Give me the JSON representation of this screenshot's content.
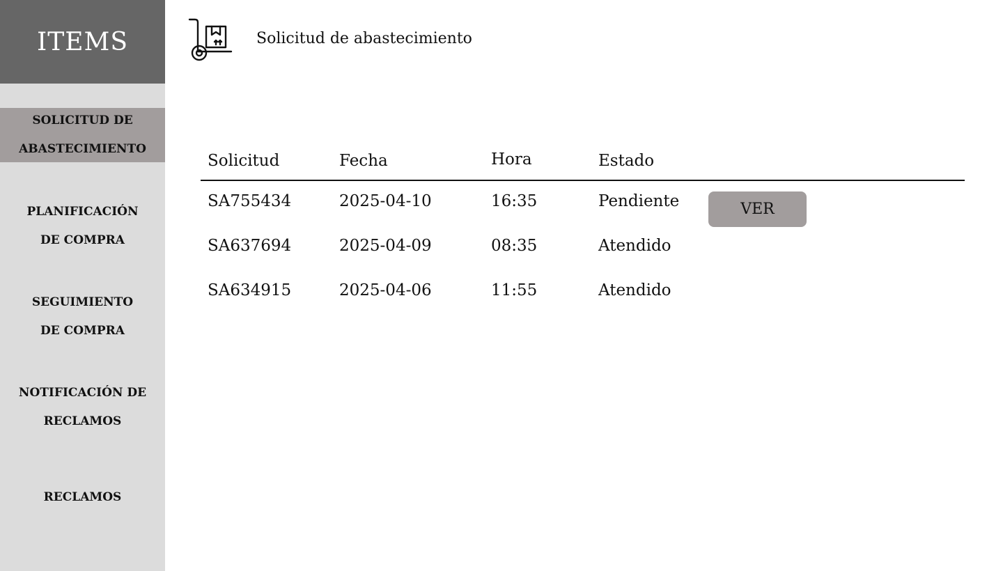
{
  "sidebar": {
    "title": "ITEMS",
    "items": [
      {
        "label": "SOLICITUD DE\nABASTECIMIENTO",
        "active": true
      },
      {
        "label": "PLANIFICACIÓN\nDE COMPRA",
        "active": false
      },
      {
        "label": "SEGUIMIENTO\nDE COMPRA",
        "active": false
      },
      {
        "label": "NOTIFICACIÓN DE\nRECLAMOS",
        "active": false
      },
      {
        "label": "RECLAMOS",
        "active": false
      }
    ]
  },
  "header": {
    "icon": "hand-truck-box-icon",
    "title": "Solicitud de abastecimiento"
  },
  "table": {
    "columns": [
      "Solicitud",
      "Fecha",
      "Hora",
      "Estado"
    ],
    "rows": [
      {
        "solicitud": "SA755434",
        "fecha": "2025-04-10",
        "hora": "16:35",
        "estado": "Pendiente",
        "action": "VER"
      },
      {
        "solicitud": "SA637694",
        "fecha": "2025-04-09",
        "hora": "08:35",
        "estado": "Atendido"
      },
      {
        "solicitud": "SA634915",
        "fecha": "2025-04-06",
        "hora": "11:55",
        "estado": "Atendido"
      }
    ]
  },
  "colors": {
    "sidebar_header": "#666666",
    "sidebar_bg": "#dcdcdc",
    "active_item": "#a29d9d",
    "button_bg": "#a29d9d"
  }
}
